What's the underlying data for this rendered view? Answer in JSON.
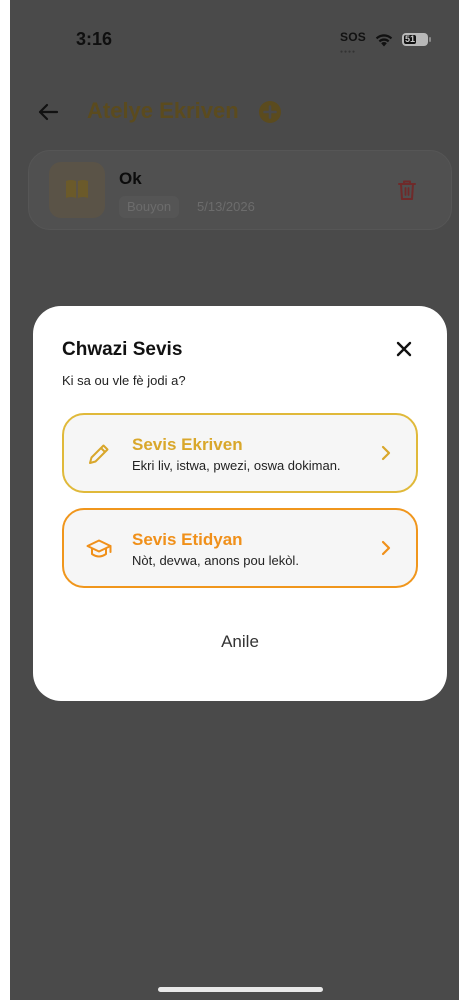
{
  "status_bar": {
    "time": "3:16",
    "sos_label": "SOS",
    "battery_level": "51",
    "icons": [
      "wifi-icon",
      "battery-icon"
    ]
  },
  "header": {
    "title": "Atelye Ekriven",
    "icons": [
      "back-arrow-icon",
      "add-circle-icon"
    ]
  },
  "documents": [
    {
      "title": "Ok",
      "badge": "Bouyon",
      "date": "5/13/2026",
      "icons": [
        "book-icon",
        "trash-icon"
      ]
    }
  ],
  "modal": {
    "title": "Chwazi Sevis",
    "subtitle": "Ki sa ou vle fè jodi a?",
    "options": [
      {
        "title": "Sevis Ekriven",
        "description": "Ekri liv, istwa, pwezi, oswa dokiman.",
        "icon": "pencil-icon",
        "accent": "#e0b93a"
      },
      {
        "title": "Sevis Etidyan",
        "description": "Nòt, devwa, anons pou lekòl.",
        "icon": "graduation-cap-icon",
        "accent": "#f0961c"
      }
    ],
    "cancel_label": "Anile"
  },
  "colors": {
    "overlay": "#4a4a4a",
    "gold": "#d9a72b",
    "orange": "#f0901a",
    "delete_red": "#6f2a2a"
  }
}
